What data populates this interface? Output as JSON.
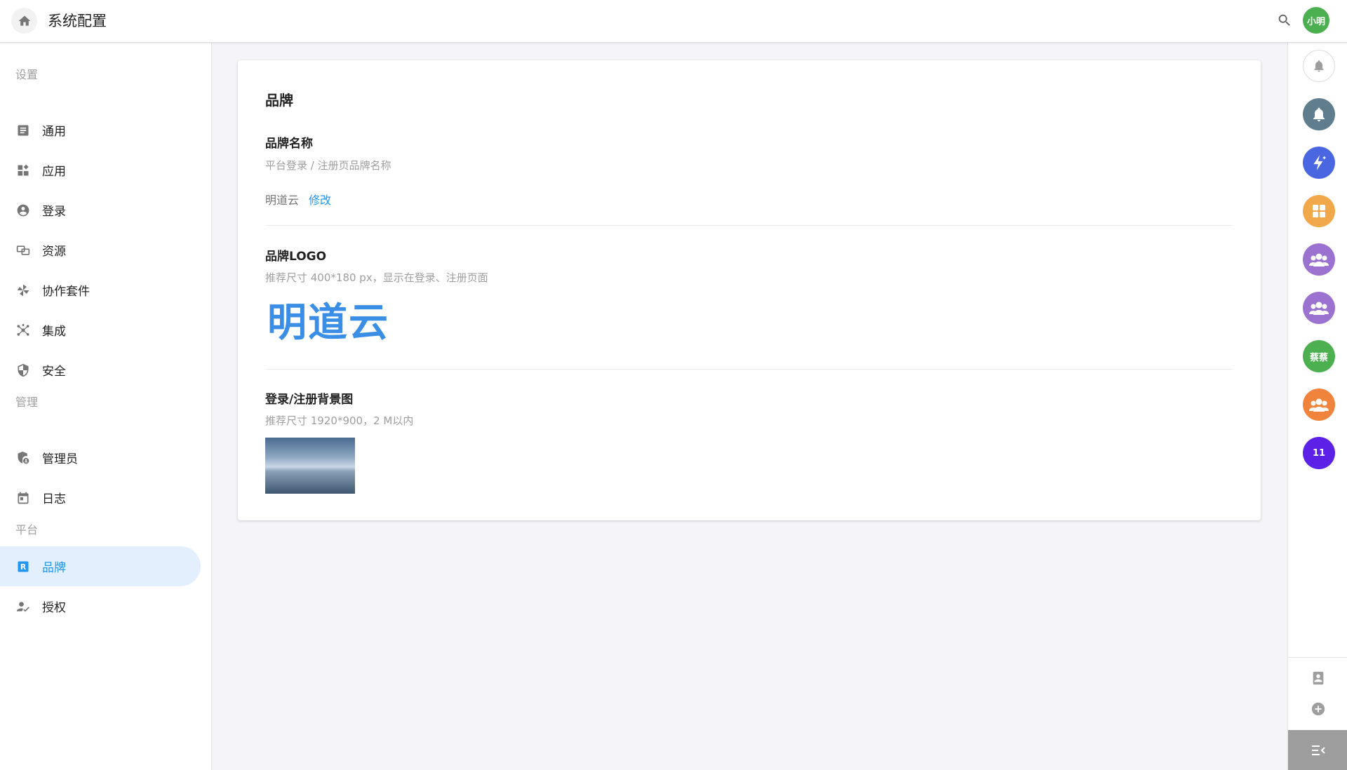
{
  "header": {
    "title": "系统配置",
    "user_avatar_text": "小明"
  },
  "sidebar": {
    "sections": [
      {
        "label": "设置",
        "items": [
          {
            "label": "通用",
            "icon": "article-icon"
          },
          {
            "label": "应用",
            "icon": "apps-grid-icon"
          },
          {
            "label": "登录",
            "icon": "account-circle-icon"
          },
          {
            "label": "资源",
            "icon": "resources-icon"
          },
          {
            "label": "协作套件",
            "icon": "pinwheel-icon"
          },
          {
            "label": "集成",
            "icon": "integration-hub-icon"
          },
          {
            "label": "安全",
            "icon": "shield-icon"
          }
        ]
      },
      {
        "label": "管理",
        "items": [
          {
            "label": "管理员",
            "icon": "admin-shield-icon"
          },
          {
            "label": "日志",
            "icon": "calendar-icon"
          }
        ]
      },
      {
        "label": "平台",
        "items": [
          {
            "label": "品牌",
            "icon": "brand-r-icon",
            "active": true
          },
          {
            "label": "授权",
            "icon": "person-check-icon"
          }
        ]
      }
    ]
  },
  "card": {
    "title": "品牌",
    "brand_name": {
      "label": "品牌名称",
      "desc": "平台登录 / 注册页品牌名称",
      "value": "明道云",
      "edit_label": "修改"
    },
    "brand_logo": {
      "label": "品牌LOGO",
      "desc": "推荐尺寸 400*180 px，显示在登录、注册页面",
      "logo_text": "明道云"
    },
    "bg_image": {
      "label": "登录/注册背景图",
      "desc": "推荐尺寸 1920*900，2 M以内"
    }
  },
  "rail": {
    "buttons": [
      {
        "name": "notification-outline-button",
        "icon": "bell-icon"
      },
      {
        "name": "notification-bot-button",
        "icon": "bell-icon",
        "color": "#5f7d8c"
      },
      {
        "name": "ai-assistant-button",
        "icon": "sparkle-bolt-icon",
        "color": "#4a66e0"
      },
      {
        "name": "app-group-button",
        "icon": "grid-icon",
        "color": "#f0a84a"
      },
      {
        "name": "group-chat-button-1",
        "icon": "group-icon",
        "color": "#9b72cf"
      },
      {
        "name": "group-chat-button-2",
        "icon": "group-icon",
        "color": "#9b72cf"
      },
      {
        "name": "contact-avatar-caicai",
        "text": "蔡蔡",
        "color": "#4caf50"
      },
      {
        "name": "group-chat-button-3",
        "icon": "group-icon",
        "color": "#f0843c"
      },
      {
        "name": "contact-avatar-11",
        "text": "11",
        "color": "#5b21e6"
      }
    ]
  }
}
